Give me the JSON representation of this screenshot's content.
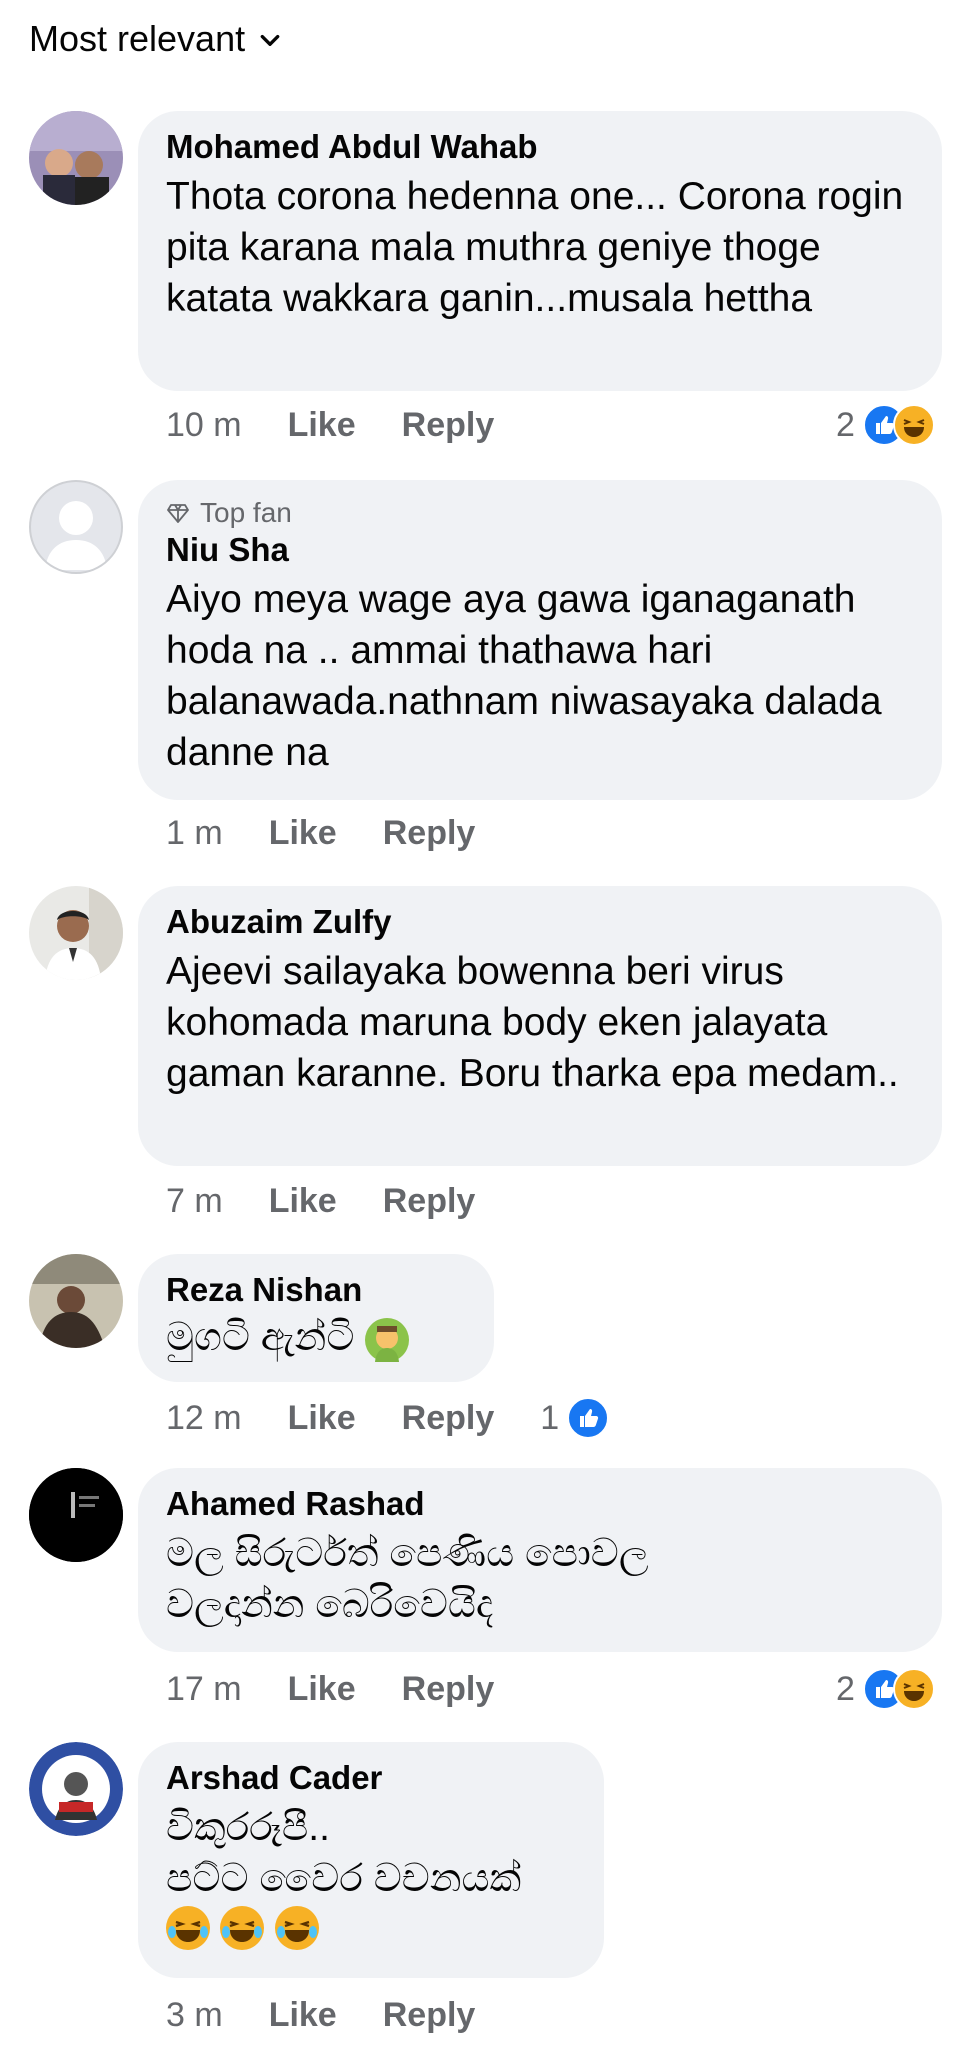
{
  "sort": {
    "label": "Most relevant"
  },
  "comments": [
    {
      "author": "Mohamed Abdul Wahab",
      "text": "Thota corona hedenna one... Corona rogin pita karana mala muthra geniye thoge katata wakkara ganin...musala hettha",
      "time": "10 m",
      "like": "Like",
      "reply": "Reply",
      "reaction_count": "2",
      "reactions": [
        "like-icon",
        "haha-icon"
      ]
    },
    {
      "badge": "Top fan",
      "author": "Niu Sha",
      "text": "Aiyo meya wage aya gawa iganaganath hoda na .. ammai thathawa hari balanawada.nathnam niwasayaka dalada danne na",
      "time": "1 m",
      "like": "Like",
      "reply": "Reply"
    },
    {
      "author": "Abuzaim Zulfy",
      "text": "Ajeevi sailayaka bowenna beri virus kohomada maruna body eken jalayata gaman karanne. Boru tharka epa medam..",
      "time": "7 m",
      "like": "Like",
      "reply": "Reply"
    },
    {
      "author": "Reza Nishan",
      "text": "මුගටි ඇන්ටි",
      "emoji": "facepalm-emoji",
      "time": "12 m",
      "like": "Like",
      "reply": "Reply",
      "reaction_count": "1",
      "reactions": [
        "like-icon"
      ]
    },
    {
      "author": "Ahamed Rashad",
      "text": "මල සිරුර්ටත් පෙණිය පොවල වලදාන්න බෙරිවෙයිද",
      "time": "17 m",
      "like": "Like",
      "reply": "Reply",
      "reaction_count": "2",
      "reactions": [
        "like-icon",
        "haha-icon"
      ]
    },
    {
      "author": "Arshad Cader",
      "text_line1": "විකුරරූපී..",
      "text_line2": "පට්ට වෛර වචනයක්",
      "emoji": "laughing-emoji x3",
      "time": "3 m",
      "like": "Like",
      "reply": "Reply"
    }
  ],
  "colors": {
    "bubble": "#f0f2f5",
    "meta": "#65676b",
    "like": "#1877f2",
    "haha": "#f7b125"
  }
}
